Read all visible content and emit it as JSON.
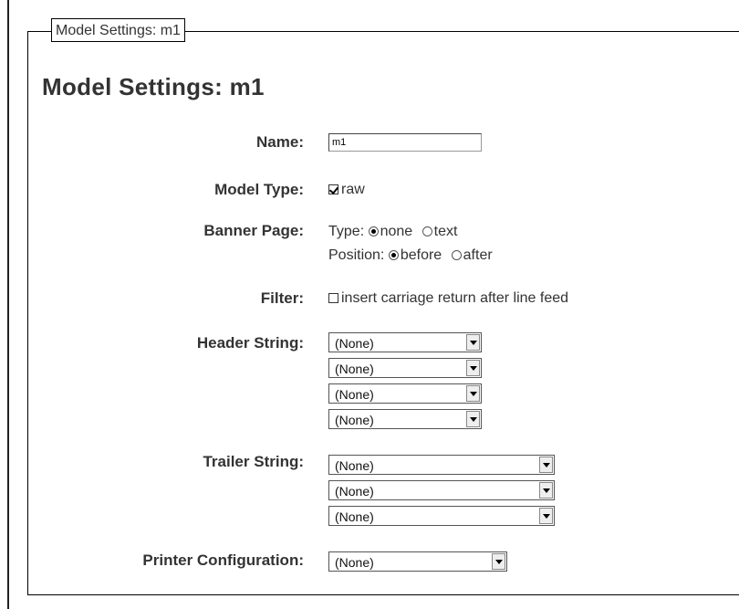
{
  "legend": "Model Settings: m1",
  "title": "Model Settings: m1",
  "name": {
    "label": "Name:",
    "value": "m1"
  },
  "model_type": {
    "label": "Model Type:",
    "option": "raw",
    "checked": true
  },
  "banner_page": {
    "label": "Banner Page:",
    "type_label": "Type:",
    "type_options": [
      "none",
      "text"
    ],
    "type_selected": "none",
    "position_label": "Position:",
    "position_options": [
      "before",
      "after"
    ],
    "position_selected": "before"
  },
  "filter": {
    "label": "Filter:",
    "option": "insert carriage return after line feed",
    "checked": false
  },
  "header_string": {
    "label": "Header String:",
    "selects": [
      "(None)",
      "(None)",
      "(None)",
      "(None)"
    ]
  },
  "trailer_string": {
    "label": "Trailer String:",
    "selects": [
      "(None)",
      "(None)",
      "(None)"
    ]
  },
  "printer_configuration": {
    "label": "Printer Configuration:",
    "value": "(None)"
  }
}
